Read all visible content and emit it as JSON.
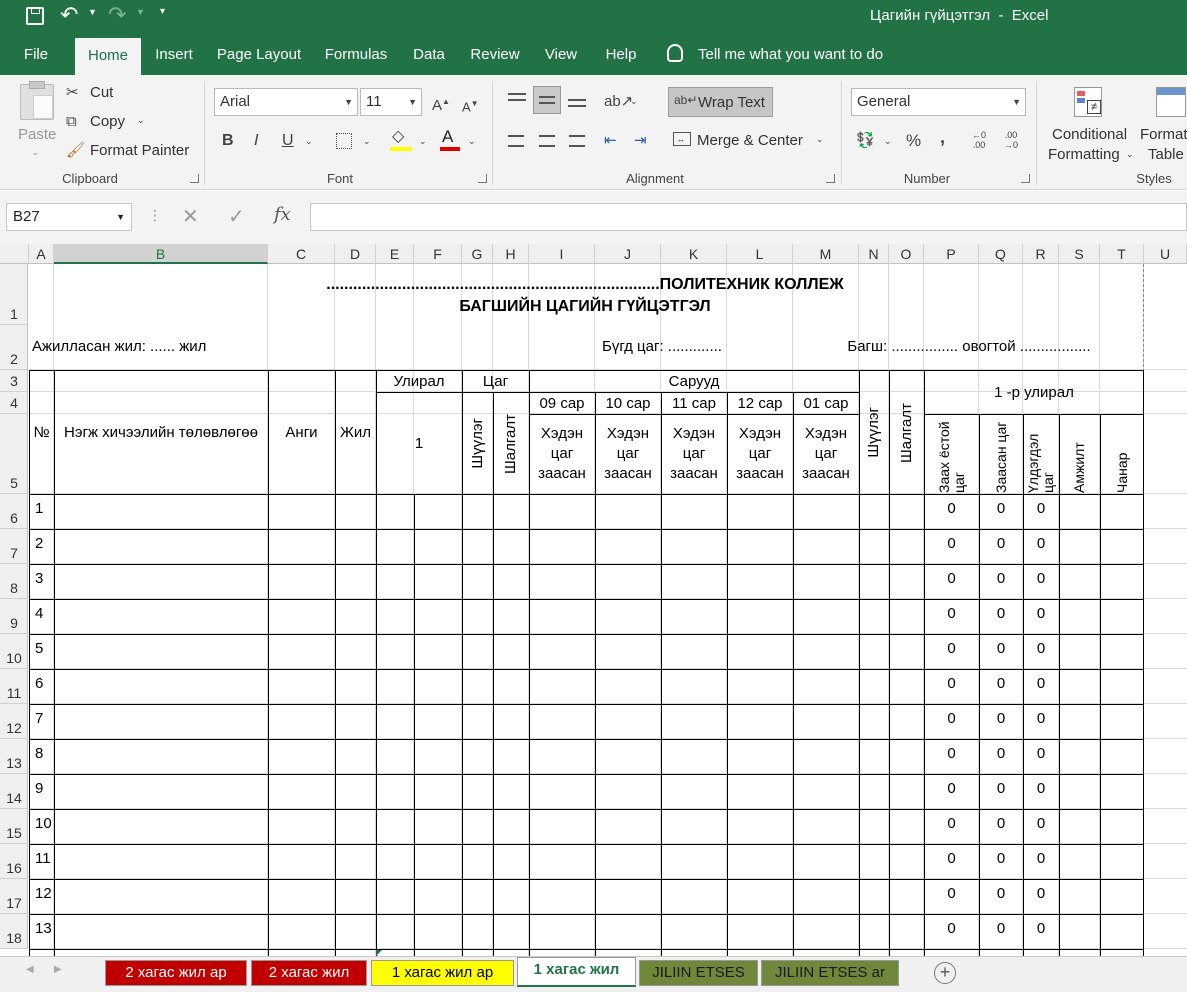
{
  "window": {
    "title": "Цагийн гүйцэтгэл  -  Excel"
  },
  "qat": {
    "save": "save-icon",
    "undo": "undo-icon",
    "redo": "redo-icon",
    "customize": "customize-icon"
  },
  "ribbon_tabs": [
    "File",
    "Home",
    "Insert",
    "Page Layout",
    "Formulas",
    "Data",
    "Review",
    "View",
    "Help"
  ],
  "tell_me": "Tell me what you want to do",
  "clipboard": {
    "paste": "Paste",
    "cut": "Cut",
    "copy": "Copy",
    "format_painter": "Format Painter",
    "label": "Clipboard"
  },
  "font": {
    "name": "Arial",
    "size": "11",
    "bold": "B",
    "italic": "I",
    "underline": "U",
    "label": "Font",
    "fill_color": "#FFFF00",
    "font_color": "#FF0000"
  },
  "alignment": {
    "wrap_text": "Wrap Text",
    "merge_center": "Merge & Center",
    "label": "Alignment"
  },
  "number": {
    "format": "General",
    "percent": "%",
    "comma": ",",
    "label": "Number"
  },
  "styles": {
    "conditional": "Conditional",
    "formatting": "Formatting",
    "format_as": "Format as",
    "table": "Table",
    "label": "Styles"
  },
  "formula_bar": {
    "name_box": "B27",
    "fx": "fx",
    "value": ""
  },
  "columns": [
    "A",
    "B",
    "C",
    "D",
    "E",
    "F",
    "G",
    "H",
    "I",
    "J",
    "K",
    "L",
    "M",
    "N",
    "O",
    "P",
    "Q",
    "R",
    "S",
    "T",
    "U"
  ],
  "rows": [
    "1",
    "2",
    "3",
    "4",
    "5",
    "6",
    "7",
    "8",
    "9",
    "10",
    "11",
    "12",
    "13",
    "14",
    "15",
    "16",
    "17",
    "18"
  ],
  "sheet": {
    "title1": "...........................................................................ПОЛИТЕХНИК КОЛЛЕЖ",
    "title2": "БАГШИЙН ЦАГИЙН ГҮЙЦЭТГЭЛ",
    "worked_years": "Ажилласан жил: ...... жил",
    "total_hours": "Бүгд цаг: .............",
    "teacher": "Багш: ................ овогтой .................",
    "h_no": "№",
    "h_plan": "Нэгж хичээлийн төлөвлөгөө",
    "h_class": "Анги",
    "h_year": "Жил",
    "h_term": "Улирал",
    "h_term_num": "1",
    "h_hour": "Цаг",
    "h_exam": "Шүүлэг",
    "h_test": "Шалгалт",
    "h_months": "Сарууд",
    "months": [
      "09 сар",
      "10 сар",
      "11 сар",
      "12 сар",
      "01 сар"
    ],
    "month_sub": "Хэдэн цаг заасан",
    "h_exam2": "Шүүлэг",
    "h_test2": "Шалгалт",
    "h_term1": "1 -р улирал",
    "sub_cols": [
      "Заах ёстой цаг",
      "Заасан цаг",
      "Үлдэгдэл цаг",
      "Амжилт",
      "Чанар"
    ],
    "row_numbers": [
      "1",
      "2",
      "3",
      "4",
      "5",
      "6",
      "7",
      "8",
      "9",
      "10",
      "11",
      "12",
      "13"
    ],
    "zero": "0"
  },
  "sheet_tabs": [
    {
      "name": "2 хагас жил ар",
      "color": "#C00000",
      "text": "#FFFFFF"
    },
    {
      "name": "2 хагас жил",
      "color": "#C00000",
      "text": "#FFFFFF"
    },
    {
      "name": "1 хагас жил ар",
      "color": "#FFFF00",
      "text": "#000000"
    },
    {
      "name": "1 хагас жил",
      "color": "#FFFFFF",
      "text": "#217346"
    },
    {
      "name": "JILIIN ETSES",
      "color": "#70883A",
      "text": "#1a1a1a"
    },
    {
      "name": "JILIIN ETSES ar",
      "color": "#70883A",
      "text": "#1a1a1a"
    }
  ]
}
